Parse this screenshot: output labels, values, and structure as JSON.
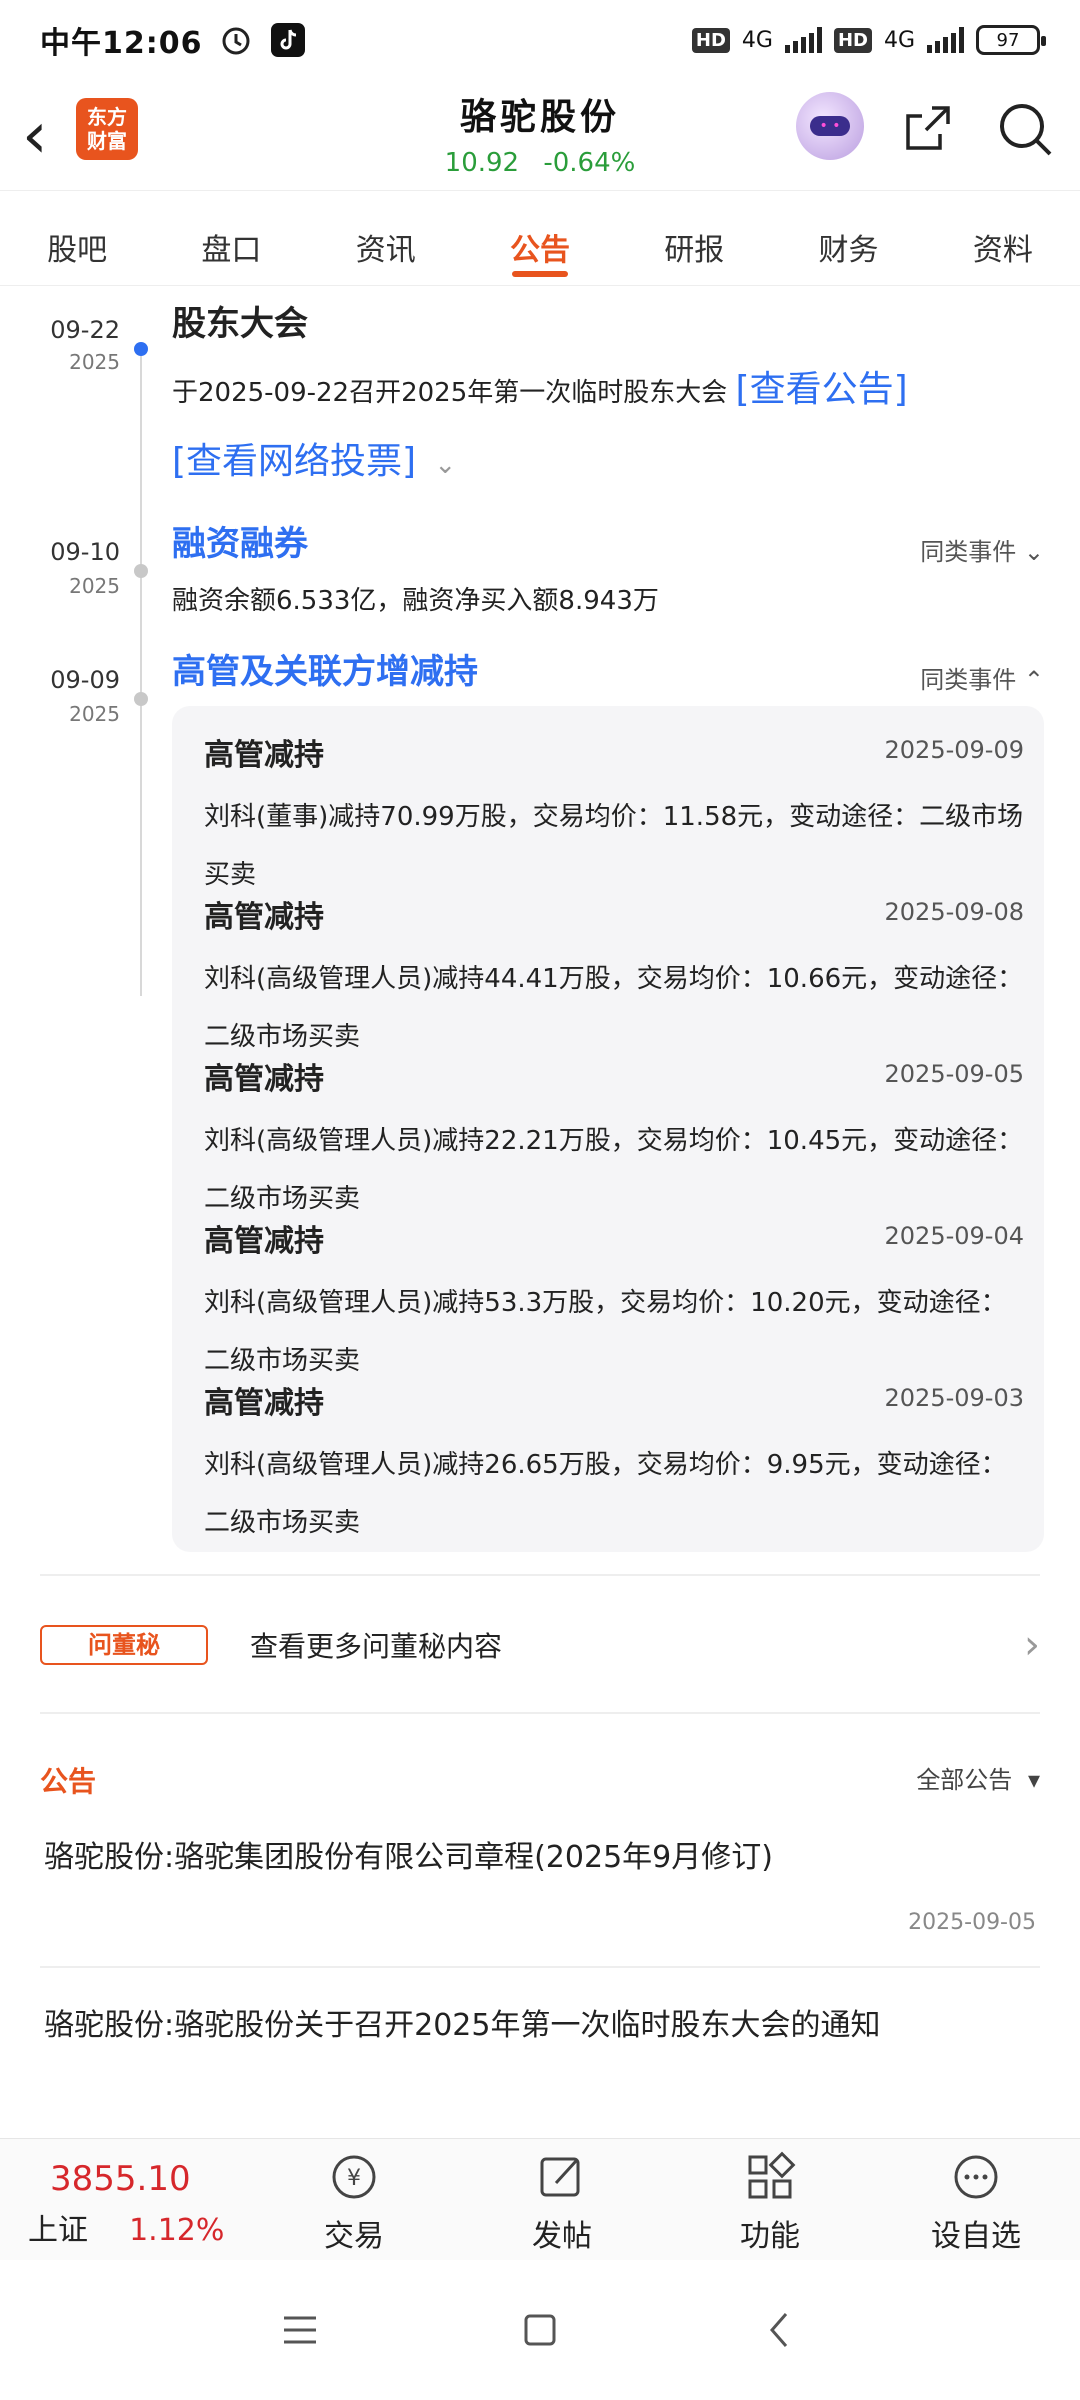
{
  "status_bar": {
    "time": "中午12:06",
    "hd1": "HD",
    "net1": "4G",
    "hd2": "HD",
    "net2": "4G",
    "battery": "97"
  },
  "header": {
    "back": "‹",
    "logo_line1": "东方",
    "logo_line2": "财富",
    "stock_name": "骆驼股份",
    "price": "10.92",
    "change_pct": "-0.64%"
  },
  "tabs": [
    {
      "label": "股吧"
    },
    {
      "label": "盘口"
    },
    {
      "label": "资讯"
    },
    {
      "label": "公告"
    },
    {
      "label": "研报"
    },
    {
      "label": "财务"
    },
    {
      "label": "资料"
    }
  ],
  "timeline": {
    "events": [
      {
        "date": "09-22",
        "year": "2025",
        "title": "股东大会",
        "text": "于2025-09-22召开2025年第一次临时股东大会",
        "link1": "[查看公告]",
        "link2": "[查看网络投票]"
      },
      {
        "date": "09-10",
        "year": "2025",
        "title": "融资融券",
        "similar": "同类事件",
        "text": "融资余额6.533亿，融资净买入额8.943万"
      },
      {
        "date": "09-09",
        "year": "2025",
        "title": "高管及关联方增减持",
        "similar": "同类事件"
      }
    ],
    "card_items": [
      {
        "title": "高管减持",
        "date": "2025-09-09",
        "desc": "刘科(董事)减持70.99万股，交易均价：11.58元，变动途径：二级市场买卖"
      },
      {
        "title": "高管减持",
        "date": "2025-09-08",
        "desc": "刘科(高级管理人员)减持44.41万股，交易均价：10.66元，变动途径：二级市场买卖"
      },
      {
        "title": "高管减持",
        "date": "2025-09-05",
        "desc": "刘科(高级管理人员)减持22.21万股，交易均价：10.45元，变动途径：二级市场买卖"
      },
      {
        "title": "高管减持",
        "date": "2025-09-04",
        "desc": "刘科(高级管理人员)减持53.3万股，交易均价：10.20元，变动途径：二级市场买卖"
      },
      {
        "title": "高管减持",
        "date": "2025-09-03",
        "desc": "刘科(高级管理人员)减持26.65万股，交易均价：9.95元，变动途径：二级市场买卖"
      }
    ]
  },
  "dongmi": {
    "badge": "问董秘",
    "text": "查看更多问董秘内容"
  },
  "announcements": {
    "title": "公告",
    "filter": "全部公告",
    "items": [
      {
        "title": "骆驼股份:骆驼集团股份有限公司章程(2025年9月修订)",
        "date": "2025-09-05"
      },
      {
        "title": "骆驼股份:骆驼股份关于召开2025年第一次临时股东大会的通知"
      }
    ]
  },
  "bottom_nav": {
    "market_value": "3855.10",
    "market_name": "上证",
    "market_pct": "1.12%",
    "items": [
      {
        "label": "交易",
        "icon": "trade-icon"
      },
      {
        "label": "发帖",
        "icon": "post-icon"
      },
      {
        "label": "功能",
        "icon": "grid-icon"
      },
      {
        "label": "设自选",
        "icon": "more-icon"
      }
    ]
  },
  "colors": {
    "accent": "#e8541e",
    "link": "#2e6ff1",
    "up": "#d6272b",
    "down": "#2a9d3a"
  }
}
